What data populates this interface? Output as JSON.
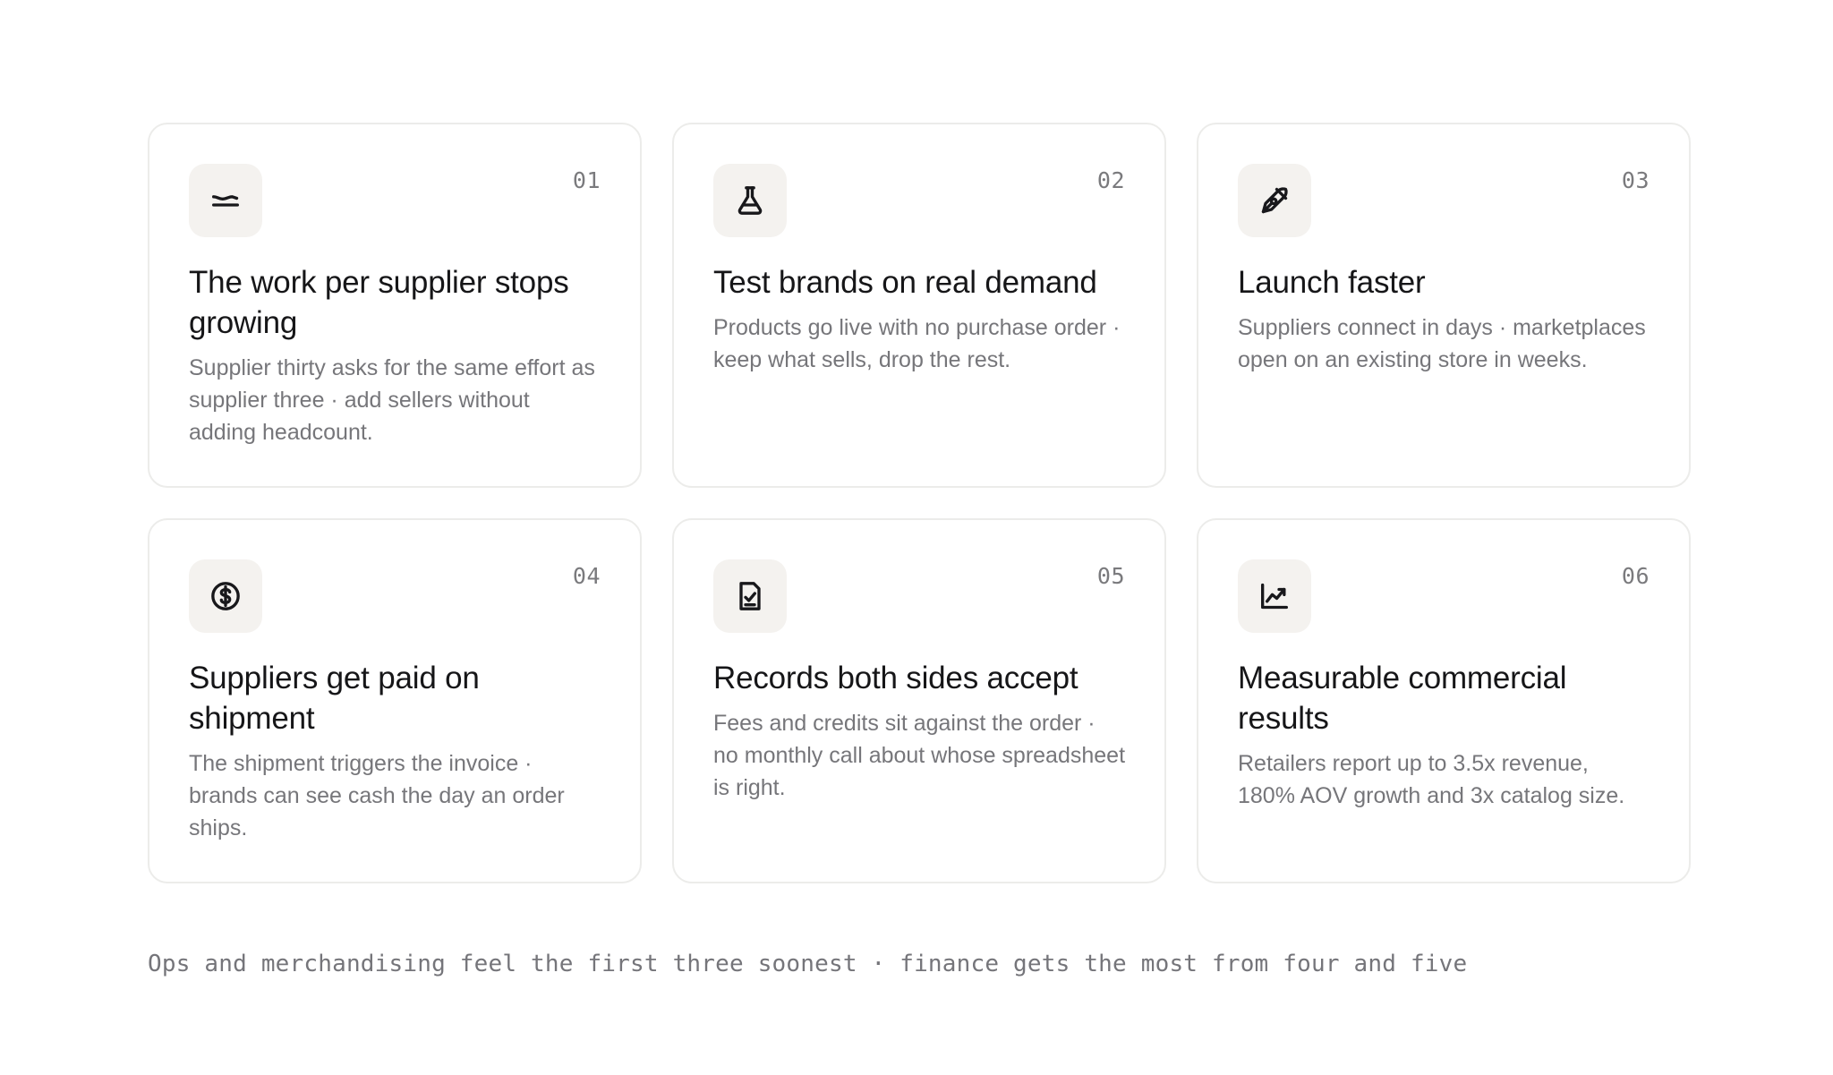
{
  "cards": [
    {
      "number": "01",
      "icon": "trend-flat-icon",
      "title": "The work per supplier stops growing",
      "description": "Supplier thirty asks for the same effort as supplier three · add sellers without adding headcount."
    },
    {
      "number": "02",
      "icon": "flask-icon",
      "title": "Test brands on real demand",
      "description": "Products go live with no purchase order · keep what sells, drop the rest."
    },
    {
      "number": "03",
      "icon": "rocket-icon",
      "title": "Launch faster",
      "description": "Suppliers connect in days · marketplaces open on an existing store in weeks."
    },
    {
      "number": "04",
      "icon": "dollar-circle-icon",
      "title": "Suppliers get paid on shipment",
      "description": "The shipment triggers the invoice · brands can see cash the day an order ships."
    },
    {
      "number": "05",
      "icon": "file-check-icon",
      "title": "Records both sides accept",
      "description": "Fees and credits sit against the order · no monthly call about whose spreadsheet is right."
    },
    {
      "number": "06",
      "icon": "line-chart-icon",
      "title": "Measurable commercial results",
      "description": "Retailers report up to 3.5x revenue, 180% AOV growth and 3x catalog size."
    }
  ],
  "footnote": "Ops and merchandising feel the first three soonest · finance gets the most from four and five",
  "colors": {
    "card_border": "#ececea",
    "icon_tile": "#f4f2ef",
    "title": "#161618",
    "muted": "#76767a"
  }
}
